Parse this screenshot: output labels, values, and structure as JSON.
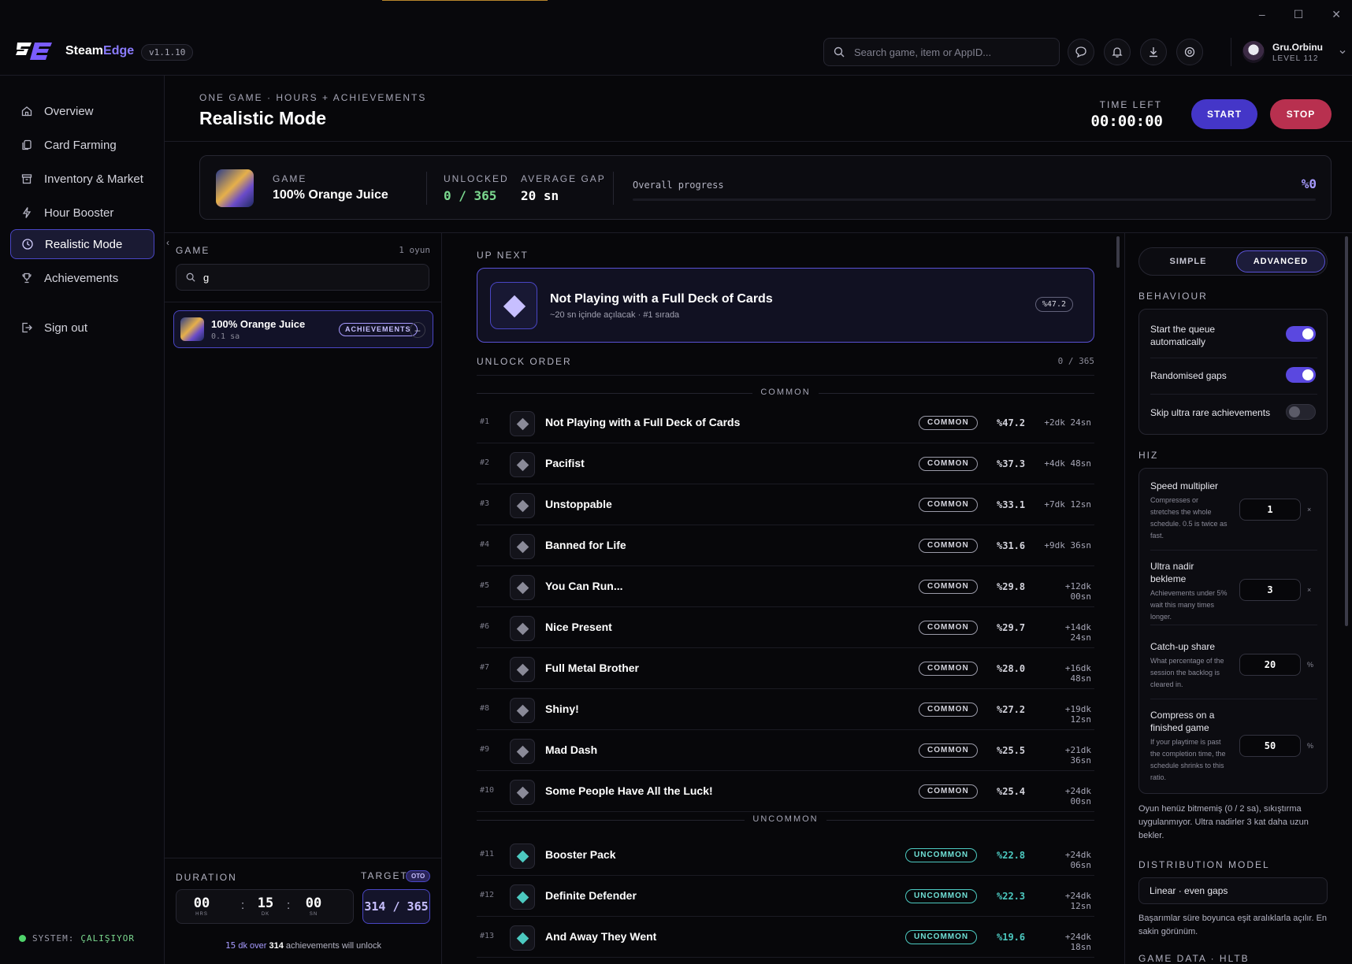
{
  "app": {
    "brand_a": "Steam",
    "brand_b": "Edge",
    "version": "v1.1.10"
  },
  "search": {
    "placeholder": "Search game, item or AppID..."
  },
  "user": {
    "name": "Gru.Orbinu",
    "level": "LEVEL 112"
  },
  "sidebar": {
    "items": [
      {
        "label": "Overview",
        "icon": "home-icon"
      },
      {
        "label": "Card Farming",
        "icon": "cards-icon"
      },
      {
        "label": "Inventory & Market",
        "icon": "archive-icon"
      },
      {
        "label": "Hour Booster",
        "icon": "bolt-icon"
      },
      {
        "label": "Realistic Mode",
        "icon": "clock-icon",
        "active": true
      },
      {
        "label": "Achievements",
        "icon": "trophy-icon"
      }
    ],
    "signout": "Sign out",
    "system_label": "SYSTEM:",
    "system_value": "ÇALIŞIYOR"
  },
  "header": {
    "kicker": "ONE GAME · HOURS + ACHIEVEMENTS",
    "title": "Realistic Mode",
    "time_left_label": "TIME LEFT",
    "time_left": "00:00:00",
    "start": "START",
    "stop": "STOP"
  },
  "game_card": {
    "game_label": "GAME",
    "game_name": "100% Orange Juice",
    "unlocked_label": "UNLOCKED",
    "unlocked": "0 / 365",
    "gap_label": "AVERAGE GAP",
    "gap": "20 sn",
    "progress_label": "Overall progress",
    "progress_text": "%0",
    "progress": 0
  },
  "game_list": {
    "label": "GAME",
    "count": "1 oyun",
    "search_value": "g",
    "item_name": "100% Orange Juice",
    "item_sub": "0.1 sa",
    "item_badge": "ACHIEVEMENTS",
    "duration_label": "DURATION",
    "target_label": "TARGET",
    "target_badge": "OTO",
    "hours": "00",
    "hours_unit": "HRS",
    "minutes": "15",
    "minutes_unit": "DK",
    "seconds": "00",
    "seconds_unit": "SN",
    "target": "314 / 365",
    "note_min": "15",
    "note_a": "dk over",
    "note_count": "314",
    "note_b": "achievements will unlock"
  },
  "up_next": {
    "label": "UP NEXT",
    "title": "Not Playing with a Full Deck of Cards",
    "sub": "~20 sn içinde açılacak · #1 sırada",
    "pct": "%47.2"
  },
  "unlock_order": {
    "label": "UNLOCK ORDER",
    "count": "0 / 365",
    "section_common": "COMMON",
    "section_uncommon": "UNCOMMON",
    "rows": [
      {
        "idx": "#1",
        "title": "Not Playing with a Full Deck of Cards",
        "rarity": "COMMON",
        "pct": "%47.2",
        "gap": "+2dk 24sn"
      },
      {
        "idx": "#2",
        "title": "Pacifist",
        "rarity": "COMMON",
        "pct": "%37.3",
        "gap": "+4dk 48sn"
      },
      {
        "idx": "#3",
        "title": "Unstoppable",
        "rarity": "COMMON",
        "pct": "%33.1",
        "gap": "+7dk 12sn"
      },
      {
        "idx": "#4",
        "title": "Banned for Life",
        "rarity": "COMMON",
        "pct": "%31.6",
        "gap": "+9dk 36sn"
      },
      {
        "idx": "#5",
        "title": "You Can Run...",
        "rarity": "COMMON",
        "pct": "%29.8",
        "gap": "+12dk 00sn"
      },
      {
        "idx": "#6",
        "title": "Nice Present",
        "rarity": "COMMON",
        "pct": "%29.7",
        "gap": "+14dk 24sn"
      },
      {
        "idx": "#7",
        "title": "Full Metal Brother",
        "rarity": "COMMON",
        "pct": "%28.0",
        "gap": "+16dk 48sn"
      },
      {
        "idx": "#8",
        "title": "Shiny!",
        "rarity": "COMMON",
        "pct": "%27.2",
        "gap": "+19dk 12sn"
      },
      {
        "idx": "#9",
        "title": "Mad Dash",
        "rarity": "COMMON",
        "pct": "%25.5",
        "gap": "+21dk 36sn"
      },
      {
        "idx": "#10",
        "title": "Some People Have All the Luck!",
        "rarity": "COMMON",
        "pct": "%25.4",
        "gap": "+24dk 00sn"
      },
      {
        "idx": "#11",
        "title": "Booster Pack",
        "rarity": "UNCOMMON",
        "pct": "%22.8",
        "gap": "+24dk 06sn"
      },
      {
        "idx": "#12",
        "title": "Definite Defender",
        "rarity": "UNCOMMON",
        "pct": "%22.3",
        "gap": "+24dk 12sn"
      },
      {
        "idx": "#13",
        "title": "And Away They Went",
        "rarity": "UNCOMMON",
        "pct": "%19.6",
        "gap": "+24dk 18sn"
      }
    ]
  },
  "settings": {
    "simple": "SIMPLE",
    "advanced": "ADVANCED",
    "behaviour_label": "BEHAVIOUR",
    "toggles": [
      {
        "label": "Start the queue automatically",
        "on": true
      },
      {
        "label": "Randomised gaps",
        "on": true
      },
      {
        "label": "Skip ultra rare achievements",
        "on": false
      }
    ],
    "hiz_label": "HIZ",
    "speed": [
      {
        "title": "Speed multiplier",
        "desc": "Compresses or stretches the whole schedule. 0.5 is twice as fast.",
        "value": "1",
        "unit": "×"
      },
      {
        "title": "Ultra nadir bekleme",
        "desc": "Achievements under 5% wait this many times longer.",
        "value": "3",
        "unit": "×"
      },
      {
        "title": "Catch-up share",
        "desc": "What percentage of the session the backlog is cleared in.",
        "value": "20",
        "unit": "%"
      },
      {
        "title": "Compress on a finished game",
        "desc": "If your playtime is past the completion time, the schedule shrinks to this ratio.",
        "value": "50",
        "unit": "%"
      }
    ],
    "note": "Oyun henüz bitmemiş (0 / 2 sa), sıkıştırma uygulanmıyor. Ultra nadirler 3 kat daha uzun bekler.",
    "dist_label": "DISTRIBUTION MODEL",
    "dist_value": "Linear · even gaps",
    "dist_note": "Başarımlar süre boyunca eşit aralıklarla açılır. En sakin görünüm.",
    "gamedata_label": "GAME DATA · HLTB"
  },
  "colors": {
    "accent": "#4436c8",
    "stop": "#b8304f",
    "uncommon": "#4cc9c0",
    "ok": "#7bd88f"
  }
}
